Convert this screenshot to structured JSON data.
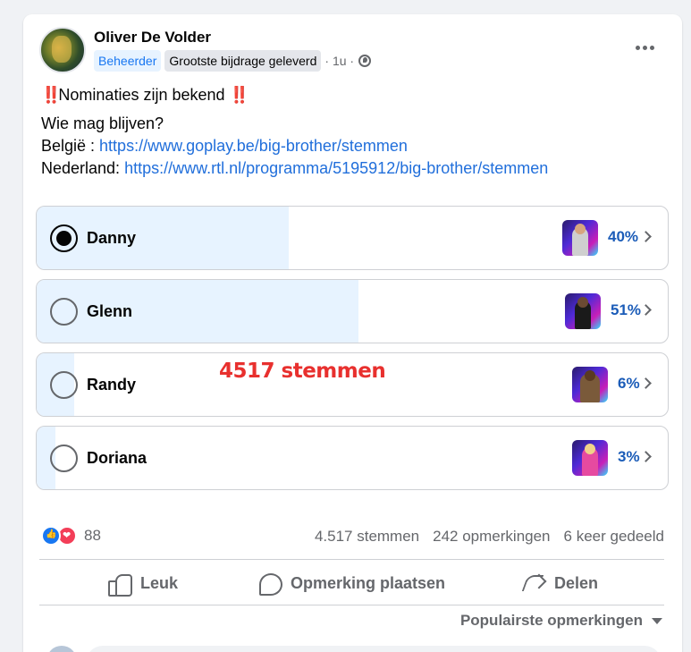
{
  "post": {
    "author": "Oliver De Volder",
    "badge_admin": "Beheerder",
    "badge_contrib": "Grootste bijdrage geleverd",
    "time": "· 1u ·",
    "title_bang_left": "‼️",
    "title": "Nominaties zijn bekend",
    "title_bang_right": "‼️",
    "question": "Wie mag blijven?",
    "belgie_label": "België : ",
    "belgie_url": "https://www.goplay.be/big-brother/stemmen",
    "nederland_label": "Nederland: ",
    "nederland_url": "https://www.rtl.nl/programma/5195912/big-brother/stemmen"
  },
  "poll": {
    "options": [
      {
        "label": "Danny",
        "percent": "40%",
        "fill": 0.4,
        "selected": true
      },
      {
        "label": "Glenn",
        "percent": "51%",
        "fill": 0.51,
        "selected": false
      },
      {
        "label": "Randy",
        "percent": "6%",
        "fill": 0.06,
        "selected": false
      },
      {
        "label": "Doriana",
        "percent": "3%",
        "fill": 0.03,
        "selected": false
      }
    ],
    "overlay_text": "4517 stemmen"
  },
  "engagement": {
    "reaction_count": "88",
    "votes": "4.517 stemmen",
    "comments": "242 opmerkingen",
    "shares": "6 keer gedeeld"
  },
  "actions": {
    "like": "Leuk",
    "comment": "Opmerking plaatsen",
    "share": "Delen"
  },
  "comments_sort": "Populairste opmerkingen",
  "colors": {
    "accent": "#1877f2",
    "link": "#216fdb",
    "bar_fill": "#e7f3ff",
    "overlay_red": "#e8302e"
  },
  "icons": [
    "globe-icon",
    "more-icon",
    "chevron-right-icon",
    "like-icon",
    "love-icon",
    "thumbs-up-icon",
    "comment-icon",
    "share-icon",
    "caret-down-icon"
  ]
}
